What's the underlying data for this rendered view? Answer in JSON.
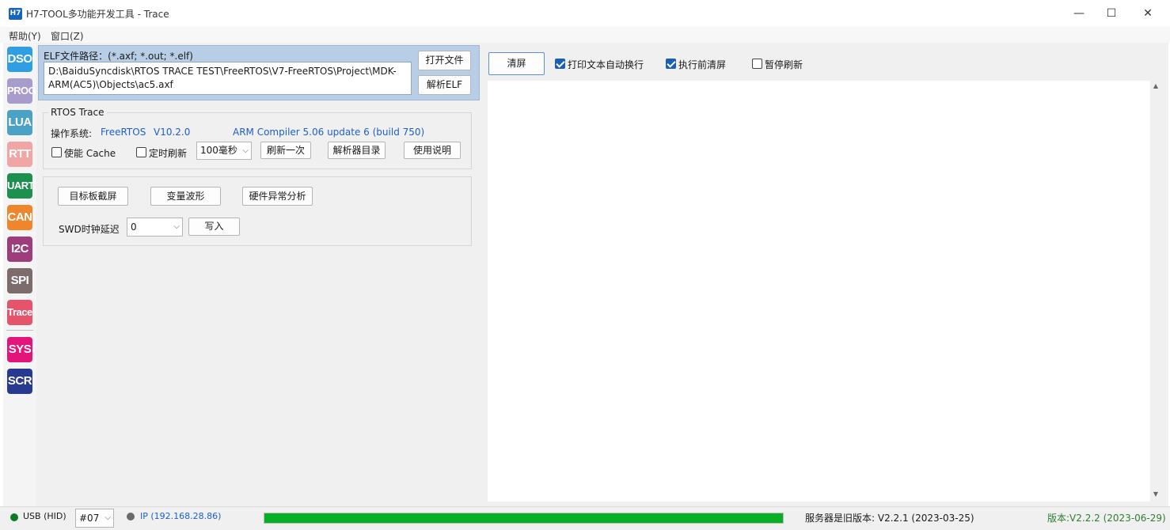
{
  "window": {
    "logo": "H7",
    "title": "H7-TOOL多功能开发工具 - Trace",
    "minimize_glyph": "—",
    "maximize_glyph": "☐",
    "close_glyph": "✕"
  },
  "menu": {
    "items": [
      "帮助(Y)",
      "窗口(Z)"
    ]
  },
  "toolbar": {
    "items": [
      {
        "label": "DSO",
        "color": "#2f9ee3"
      },
      {
        "label": "PROG",
        "color": "#a89ccd"
      },
      {
        "label": "LUA",
        "color": "#4aa2c4"
      },
      {
        "label": "RTT",
        "color": "#f1a5a5"
      },
      {
        "label": "UART",
        "color": "#1d8f4e"
      },
      {
        "label": "CAN",
        "color": "#f0862b"
      },
      {
        "label": "I2C",
        "color": "#9e3d7c"
      },
      {
        "label": "SPI",
        "color": "#7d6c6c"
      },
      {
        "label": "Trace",
        "color": "#e6546c"
      },
      {
        "label": "SYS",
        "color": "#e3147a"
      },
      {
        "label": "SCR",
        "color": "#283a8f"
      }
    ]
  },
  "elf": {
    "label": "ELF文件路径：(*.axf; *.out; *.elf)",
    "path": "D:\\BaiduSyncdisk\\RTOS TRACE TEST\\FreeRTOS\\V7-FreeRTOS\\Project\\MDK-ARM(AC5)\\Objects\\ac5.axf",
    "open_button": "打开文件",
    "parse_button": "解析ELF"
  },
  "rtos": {
    "group_title": "RTOS Trace",
    "os_label": "操作系统:",
    "os_name": "FreeRTOS",
    "os_version": "V10.2.0",
    "compiler": "ARM Compiler 5.06 update 6 (build 750)",
    "cache_label": "使能 Cache",
    "cache_checked": false,
    "timer_label": "定时刷新",
    "timer_checked": false,
    "interval_value": "100毫秒",
    "refresh_once_button": "刷新一次",
    "parser_dir_button": "解析器目录",
    "manual_button": "使用说明"
  },
  "tools": {
    "screenshot_button": "目标板截屏",
    "waveform_button": "变量波形",
    "fault_button": "硬件异常分析",
    "swd_label": "SWD时钟延迟",
    "swd_value": "0",
    "write_button": "写入"
  },
  "output": {
    "clear_button": "清屏",
    "wrap_label": "打印文本自动换行",
    "wrap_checked": true,
    "clear_before_label": "执行前清屏",
    "clear_before_checked": true,
    "pause_label": "暂停刷新",
    "pause_checked": false,
    "scroll_up_glyph": "▲",
    "scroll_down_glyph": "▼"
  },
  "status": {
    "usb_label": "USB (HID)",
    "usb_color": "#0a7a24",
    "device_value": "#07",
    "ip_label": "IP (192.168.28.86)",
    "ip_color": "#6b6b6b",
    "progress_fraction": 1.0,
    "server_text": "服务器是旧版本: V2.2.1 (2023-03-25)",
    "version_text": "版本:V2.2.2 (2023-06-29)"
  }
}
